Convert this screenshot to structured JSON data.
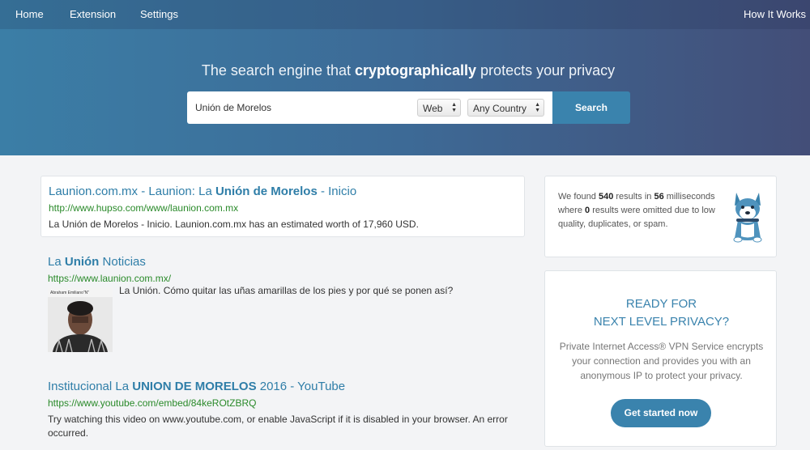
{
  "nav": {
    "home": "Home",
    "extension": "Extension",
    "settings": "Settings",
    "how_it_works": "How It Works"
  },
  "hero": {
    "tagline_pre": "The search engine that ",
    "tagline_bold": "cryptographically",
    "tagline_post": " protects your privacy"
  },
  "search": {
    "query": "Unión de Morelos",
    "type_selected": "Web",
    "country_selected": "Any Country",
    "button": "Search"
  },
  "results": [
    {
      "title_pre": "Launion.com.mx - Launion: La ",
      "title_bold": "Unión de Morelos",
      "title_post": " - Inicio",
      "url": "http://www.hupso.com/www/launion.com.mx",
      "desc": "La Unión de Morelos - Inicio. Launion.com.mx has an estimated worth of 17,960 USD."
    },
    {
      "title_pre": "La ",
      "title_bold": "Unión",
      "title_post": " Noticias",
      "url": "https://www.launion.com.mx/",
      "desc": "La Unión. Cómo quitar las uñas amarillas de los pies y por qué se ponen así?",
      "thumb_caption": "Abraham Emiliano\"N\""
    },
    {
      "title_pre": "Institucional La ",
      "title_bold": "UNION DE MORELOS",
      "title_post": " 2016 - YouTube",
      "url": "https://www.youtube.com/embed/84keROtZBRQ",
      "desc": "Try watching this video on www.youtube.com, or enable JavaScript if it is disabled in your browser. An error occurred."
    }
  ],
  "stats": {
    "t1": "We found ",
    "results_count": "540",
    "t2": " results in ",
    "ms": "56",
    "t3": " milliseconds where ",
    "omitted": "0",
    "t4": " results were omitted due to low quality, duplicates, or spam."
  },
  "promo": {
    "line1": "READY FOR",
    "line2": "NEXT LEVEL PRIVACY?",
    "body": "Private Internet Access® VPN Service encrypts your connection and provides you with an anonymous IP to protect your privacy.",
    "button": "Get started now"
  },
  "colors": {
    "accent": "#3a83ad",
    "link": "#2f7ea8",
    "url_green": "#2a8a2a"
  }
}
